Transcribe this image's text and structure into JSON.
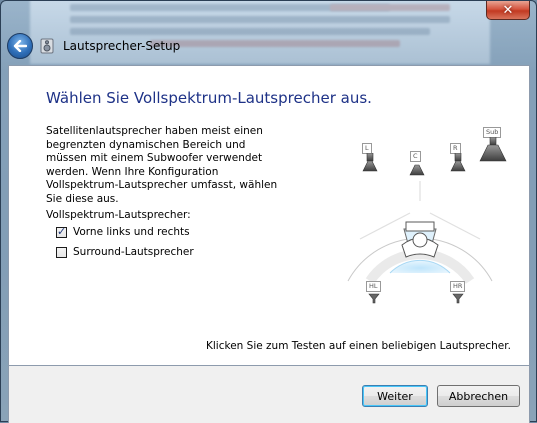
{
  "window": {
    "title": "Lautsprecher-Setup",
    "close_label": "✕"
  },
  "page": {
    "heading": "Wählen Sie Vollspektrum-Lautsprecher aus.",
    "description": "Satellitenlautsprecher haben meist einen begrenzten dynamischen Bereich und müssen mit einem Subwoofer verwendet werden. Wenn Ihre Konfiguration Vollspektrum-Lautsprecher umfasst, wählen Sie diese aus.",
    "group_label": "Vollspektrum-Lautsprecher:",
    "options": [
      {
        "label": "Vorne links und rechts",
        "checked": true
      },
      {
        "label": "Surround-Lautsprecher",
        "checked": false
      }
    ],
    "hint": "Klicken Sie zum Testen auf einen beliebigen Lautsprecher."
  },
  "speakers": {
    "L": "L",
    "C": "C",
    "R": "R",
    "Sub": "Sub",
    "HL": "HL",
    "HR": "HR"
  },
  "buttons": {
    "next": "Weiter",
    "cancel": "Abbrechen"
  },
  "colors": {
    "heading": "#1e3287",
    "listener_zone": "#9fd3f5",
    "close_button": "#c23a22"
  }
}
